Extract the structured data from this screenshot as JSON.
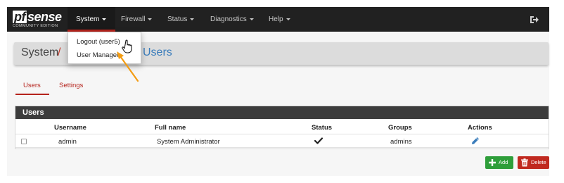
{
  "brand": {
    "logo_text": "sense",
    "logo_prefix": "pf",
    "edition": "COMMUNITY EDITION"
  },
  "nav": {
    "items": [
      {
        "label": "System",
        "active": true
      },
      {
        "label": "Firewall",
        "active": false
      },
      {
        "label": "Status",
        "active": false
      },
      {
        "label": "Diagnostics",
        "active": false
      },
      {
        "label": "Help",
        "active": false
      }
    ],
    "logout_icon": "sign-out-icon"
  },
  "dropdown": {
    "items": [
      {
        "label": "Logout (user5)"
      },
      {
        "label": "User Manager"
      }
    ]
  },
  "breadcrumb": {
    "first": "System",
    "separator": "/",
    "last": "Users"
  },
  "tabs": [
    {
      "label": "Users",
      "active": true
    },
    {
      "label": "Settings",
      "active": false
    }
  ],
  "panel": {
    "title": "Users",
    "columns": [
      "Username",
      "Full name",
      "Status",
      "Groups",
      "Actions"
    ],
    "rows": [
      {
        "username": "admin",
        "full_name": "System Administrator",
        "status_icon": "check-icon",
        "groups": "admins",
        "action_icon": "pencil-icon"
      }
    ]
  },
  "buttons": {
    "add": "Add",
    "delete": "Delete"
  },
  "colors": {
    "navbar": "#212121",
    "accent_red": "#b5231c",
    "link_blue": "#3b7dbb",
    "add_green": "#2e9e3a",
    "delete_red": "#c0291f",
    "annotation_arrow": "#f39c12"
  }
}
